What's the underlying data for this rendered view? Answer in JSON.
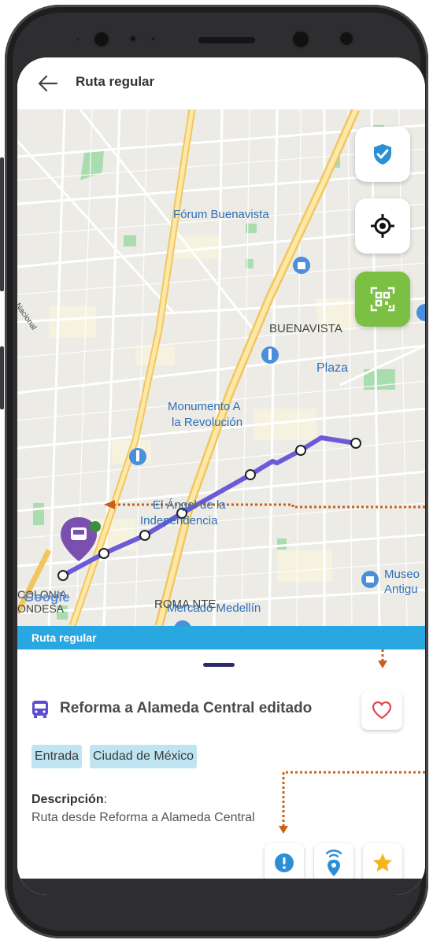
{
  "appbar": {
    "title": "Ruta regular",
    "back_icon": "arrow-back-icon"
  },
  "map": {
    "labels": {
      "forum": "Fórum Buenavista",
      "buenavista": "BUENAVISTA",
      "plaza": "Plaza",
      "monumento_1": "Monumento A",
      "monumento_2": "la Revolución",
      "angel_1": "El Ángel de la",
      "angel_2": "Independencia",
      "roma": "ROMA NTE.",
      "museo_1": "Museo",
      "museo_2": "Antigu",
      "mercado": "Mercado Medellín",
      "colonia_1": "COLONIA",
      "colonia_2": "ONDESA",
      "nacional": "rna Nacional",
      "google": "Google"
    },
    "route_color": "#6b5bd8",
    "buttons": [
      "shield-check-icon",
      "locate-icon",
      "qr-scan-icon"
    ]
  },
  "banner": {
    "text": "Ruta regular"
  },
  "sheet": {
    "route_name": "Reforma a Alameda Central editado",
    "tags": [
      "Entrada",
      "Ciudad de México"
    ],
    "description_label": "Descripción",
    "description": "Ruta desde Reforma a Alameda Central",
    "actions": [
      "alert-icon",
      "beacon-location-icon",
      "star-icon"
    ]
  },
  "colors": {
    "accent_blue": "#29a7e1",
    "green": "#7cc043",
    "route": "#6b5bd8",
    "annotation_orange": "#c8621b"
  }
}
